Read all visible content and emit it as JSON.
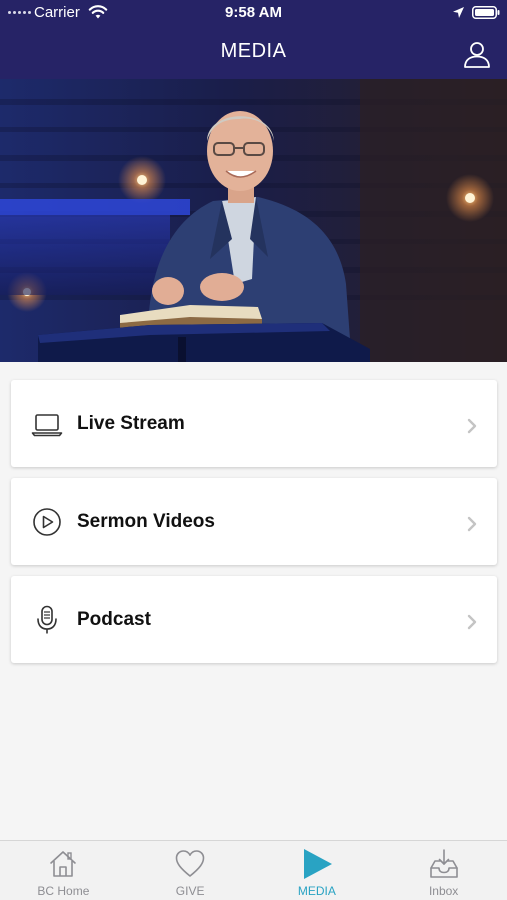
{
  "status_bar": {
    "carrier": "Carrier",
    "time": "9:58 AM",
    "icons": [
      "wifi-icon",
      "location-arrow-icon",
      "battery-icon"
    ]
  },
  "nav": {
    "title": "MEDIA",
    "right_icon": "profile-icon"
  },
  "hero": {
    "image": "pastor-speaking-at-podium"
  },
  "menu": [
    {
      "label": "Live Stream",
      "icon": "laptop-icon"
    },
    {
      "label": "Sermon Videos",
      "icon": "play-circle-icon"
    },
    {
      "label": "Podcast",
      "icon": "microphone-icon"
    }
  ],
  "tabs": [
    {
      "label": "BC Home",
      "icon": "home-icon",
      "active": false
    },
    {
      "label": "GIVE",
      "icon": "heart-icon",
      "active": false
    },
    {
      "label": "MEDIA",
      "icon": "play-icon",
      "active": true
    },
    {
      "label": "Inbox",
      "icon": "inbox-icon",
      "active": false
    }
  ],
  "colors": {
    "header_bg": "#262366",
    "accent": "#29a3c3",
    "background": "#f5f5f5",
    "inactive_tab": "#8e8e93"
  }
}
